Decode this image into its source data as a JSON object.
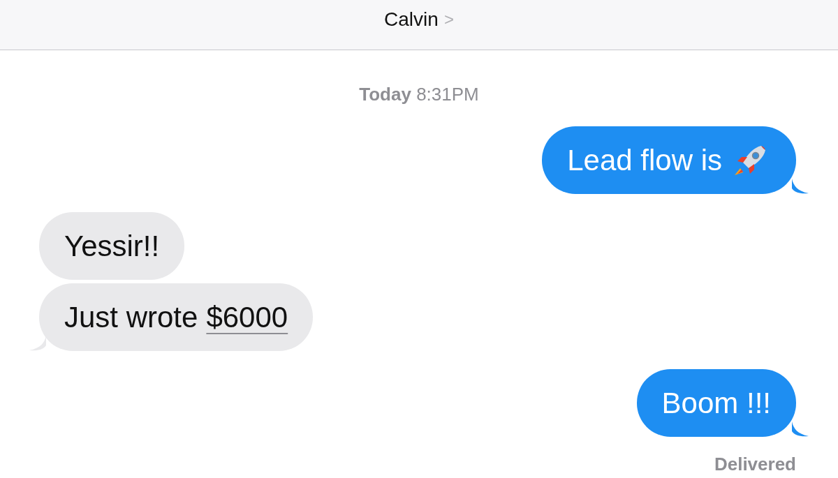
{
  "header": {
    "contact_name": "Calvin",
    "chevron": ">"
  },
  "timestamp": {
    "day": "Today",
    "time": "8:31PM"
  },
  "messages": [
    {
      "kind": "outgoing",
      "text": "Lead flow is",
      "emoji": true,
      "tail": true
    },
    {
      "kind": "incoming",
      "text": "Yessir!!",
      "emoji": false,
      "tail": false
    },
    {
      "kind": "incoming",
      "text": "Just wrote",
      "link": "$6000",
      "emoji": false,
      "tail": true
    },
    {
      "kind": "outgoing",
      "text": "Boom !!!",
      "emoji": false,
      "tail": true
    }
  ],
  "status": "Delivered"
}
